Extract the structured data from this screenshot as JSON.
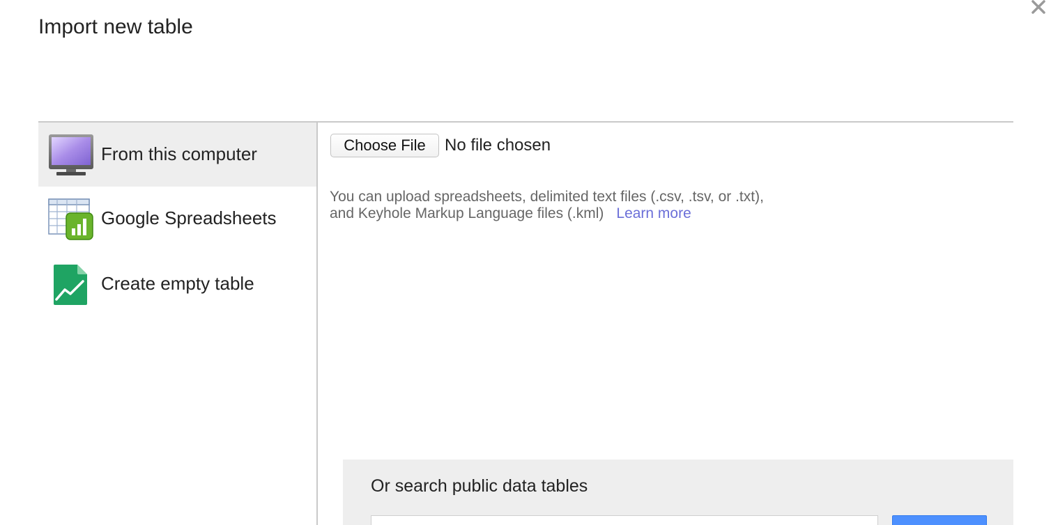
{
  "dialog": {
    "title": "Import new table",
    "close_icon": "close-icon"
  },
  "sidebar": {
    "items": [
      {
        "label": "From this computer",
        "icon": "monitor-icon",
        "active": true
      },
      {
        "label": "Google Spreadsheets",
        "icon": "spreadsheet-icon",
        "active": false
      },
      {
        "label": "Create empty table",
        "icon": "empty-table-icon",
        "active": false
      }
    ]
  },
  "upload": {
    "choose_file_label": "Choose File",
    "no_file_text": "No file chosen",
    "description_line1": "You can upload spreadsheets, delimited text files (.csv, .tsv, or .txt),",
    "description_line2": "and Keyhole Markup Language files (.kml)",
    "learn_more_label": "Learn more"
  },
  "search": {
    "title": "Or search public data tables",
    "input_value": "",
    "input_placeholder": "",
    "button_label": ""
  },
  "colors": {
    "link": "#6b6fd8",
    "active_bg": "#eeeeee",
    "search_panel_bg": "#eeeeee",
    "primary_button": "#4d90fe"
  }
}
